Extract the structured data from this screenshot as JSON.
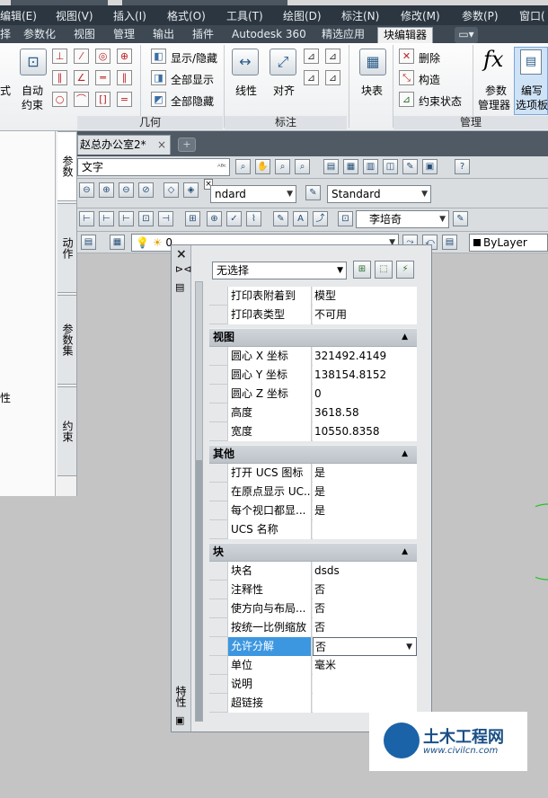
{
  "menubar": {
    "items": [
      "编辑(E)",
      "视图(V)",
      "插入(I)",
      "格式(O)",
      "工具(T)",
      "绘图(D)",
      "标注(N)",
      "修改(M)",
      "参数(P)",
      "窗口("
    ]
  },
  "ribbon_tabs": {
    "items": [
      "择",
      "参数化",
      "视图",
      "管理",
      "输出",
      "插件",
      "Autodesk 360",
      "精选应用",
      "块编辑器"
    ],
    "active_index": 8
  },
  "ribbon": {
    "auto_constrain_label_1": "自动",
    "auto_constrain_label_2": "约束",
    "partial_left_label": "式",
    "show_hide": "显示/隐藏",
    "show_all": "全部显示",
    "hide_all": "全部隐藏",
    "linear": "线性",
    "aligned": "对齐",
    "block_table": "块表",
    "delete": "删除",
    "construction": "构造",
    "constraint_status": "约束状态",
    "param_manager_1": "参数",
    "param_manager_2": "管理器",
    "edit_options_1": "编写",
    "edit_options_2": "选项板",
    "group_geometry": "几何",
    "group_dimension": "标注",
    "group_manage": "管理"
  },
  "left_palette": {
    "tabs": [
      "参数",
      "动作",
      "参数集",
      "约束"
    ],
    "selected_tab": 0,
    "partial_text": "性"
  },
  "doc_tab": {
    "title": "赵总办公室2*",
    "close": "×"
  },
  "toolbars": {
    "search_text": "文字",
    "style_dropdown_1": "ndard",
    "style_dropdown_2": "Standard",
    "dim_style_text": "李培奇",
    "layer_value": "0",
    "linetype": "ByLayer"
  },
  "properties": {
    "selector": "无选择",
    "side_title": "特性",
    "rows_top": [
      {
        "label": "打印表附着到",
        "value": "模型"
      },
      {
        "label": "打印表类型",
        "value": "不可用"
      }
    ],
    "sections": [
      {
        "title": "视图",
        "rows": [
          {
            "label": "圆心 X 坐标",
            "value": "321492.4149"
          },
          {
            "label": "圆心 Y 坐标",
            "value": "138154.8152"
          },
          {
            "label": "圆心 Z 坐标",
            "value": "0"
          },
          {
            "label": "高度",
            "value": "3618.58"
          },
          {
            "label": "宽度",
            "value": "10550.8358"
          }
        ]
      },
      {
        "title": "其他",
        "rows": [
          {
            "label": "打开 UCS 图标",
            "value": "是"
          },
          {
            "label": "在原点显示 UC...",
            "value": "是"
          },
          {
            "label": "每个视口都显...",
            "value": "是"
          },
          {
            "label": "UCS 名称",
            "value": ""
          }
        ]
      },
      {
        "title": "块",
        "rows": [
          {
            "label": "块名",
            "value": "dsds"
          },
          {
            "label": "注释性",
            "value": "否"
          },
          {
            "label": "使方向与布局...",
            "value": "否"
          },
          {
            "label": "按统一比例缩放",
            "value": "否"
          },
          {
            "label": "允许分解",
            "value": "否"
          },
          {
            "label": "单位",
            "value": "毫米"
          },
          {
            "label": "说明",
            "value": ""
          },
          {
            "label": "超链接",
            "value": ""
          }
        ]
      }
    ]
  },
  "watermark": {
    "title": "土木工程网",
    "url": "www.civilcn.com"
  },
  "colors": {
    "menubar_bg": "#2c3640",
    "ribbon_tab_bg": "#3d4853",
    "highlight_row": "#3d97e0",
    "section_header": "#c4cad0",
    "canvas_bg": "#c4c4c4",
    "circle_edge": "#23c223"
  }
}
